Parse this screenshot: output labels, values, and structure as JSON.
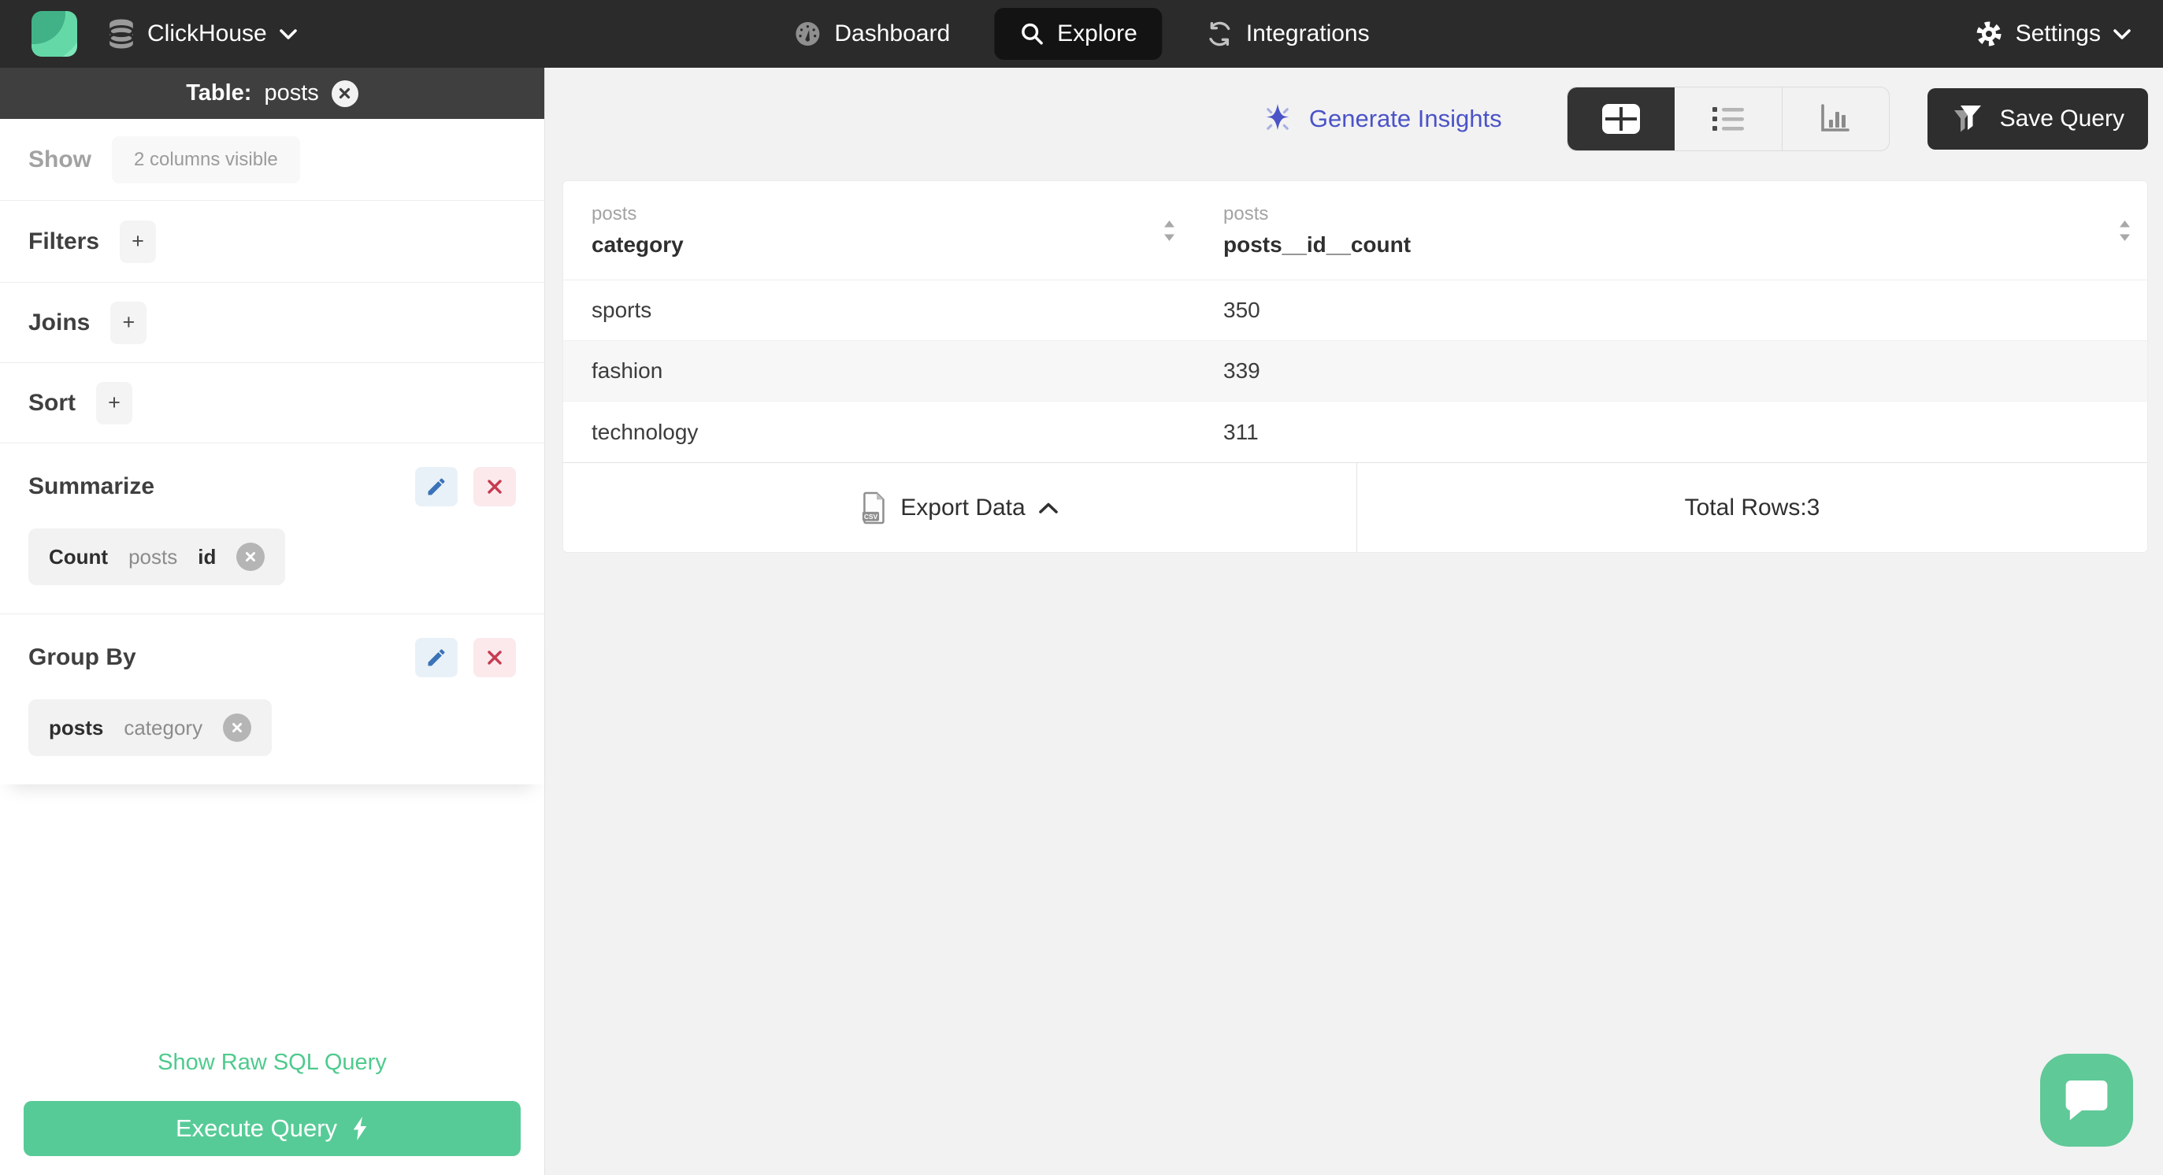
{
  "topnav": {
    "datasource": "ClickHouse",
    "items": [
      {
        "label": "Dashboard",
        "icon": "gauge-icon",
        "active": false
      },
      {
        "label": "Explore",
        "icon": "search-icon",
        "active": true
      },
      {
        "label": "Integrations",
        "icon": "sync-icon",
        "active": false
      }
    ],
    "settings_label": "Settings"
  },
  "sidebar": {
    "table_header": {
      "prefix": "Table:",
      "table_name": "posts",
      "close_icon": "close-circle-icon"
    },
    "show": {
      "label": "Show",
      "button_label": "2 columns visible"
    },
    "sections": [
      {
        "label": "Filters",
        "add_label": "+"
      },
      {
        "label": "Joins",
        "add_label": "+"
      },
      {
        "label": "Sort",
        "add_label": "+"
      }
    ],
    "summarize": {
      "title": "Summarize",
      "chip": {
        "aggregate": "Count",
        "table": "posts",
        "column": "id"
      }
    },
    "group_by": {
      "title": "Group By",
      "chip": {
        "table": "posts",
        "column": "category"
      }
    },
    "raw_sql_link": "Show Raw SQL Query",
    "execute_button": "Execute Query"
  },
  "toolbar": {
    "generate_insights_label": "Generate Insights",
    "view_modes": [
      "table-view-icon",
      "list-view-icon",
      "chart-view-icon"
    ],
    "active_view": "table",
    "save_query_label": "Save Query"
  },
  "results": {
    "columns": [
      {
        "group": "posts",
        "name": "category"
      },
      {
        "group": "posts",
        "name": "posts__id__count"
      }
    ],
    "rows": [
      {
        "category": "sports",
        "count": "350"
      },
      {
        "category": "fashion",
        "count": "339"
      },
      {
        "category": "technology",
        "count": "311"
      }
    ],
    "export_label": "Export Data",
    "total_rows_label": "Total Rows:3"
  },
  "icons": [
    "app-logo",
    "database-icon",
    "chevron-down-icon",
    "gauge-icon",
    "search-icon",
    "sync-icon",
    "gear-icon",
    "close-circle-icon",
    "plus-icon",
    "pencil-icon",
    "x-icon",
    "sparkle-icon",
    "table-view-icon",
    "list-view-icon",
    "chart-view-icon",
    "funnel-icon",
    "csv-file-icon",
    "sort-icon",
    "chevron-up-icon",
    "lightning-icon",
    "chat-icon"
  ],
  "colors": {
    "nav_bg": "#2b2b2b",
    "accent_green": "#57cb97",
    "link_green": "#4fca8e",
    "logo_green": "#65d8a7",
    "insights_indigo": "#4b53c7",
    "edit_blue": "#3a73b8",
    "delete_red": "#c73a4e",
    "alt_row": "#f7f7f8"
  }
}
